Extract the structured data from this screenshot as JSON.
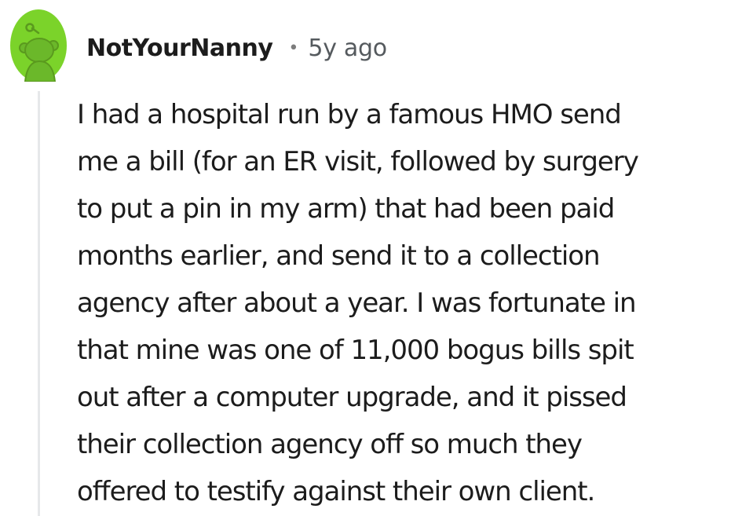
{
  "comment": {
    "author": "NotYourNanny",
    "separator": "•",
    "age": "5y ago",
    "avatar_icon": "snoo-avatar-icon",
    "avatar_color": "#7bd32a",
    "body_lines": [
      "I had a hospital run by a famous HMO send",
      "me a bill (for an ER visit, followed by surgery",
      "to put a pin in my arm) that had been paid",
      "months earlier, and send it to a collection",
      "agency after about a year. I was fortunate in",
      "that mine was one of 11,000 bogus bills spit",
      "out after a computer upgrade, and it pissed",
      "their collection agency off so much they",
      "offered to testify against their own client."
    ]
  }
}
